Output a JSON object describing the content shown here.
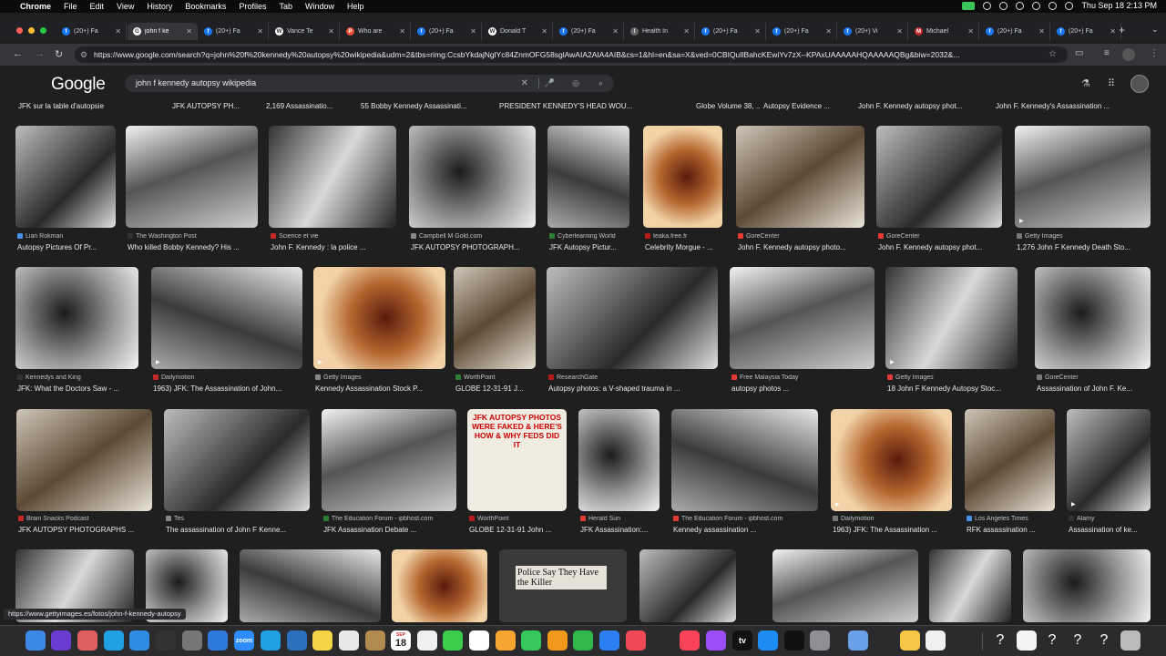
{
  "menubar": {
    "app": "Chrome",
    "items": [
      "File",
      "Edit",
      "View",
      "History",
      "Bookmarks",
      "Profiles",
      "Tab",
      "Window",
      "Help"
    ],
    "datetime": "Thu Sep 18  2:13 PM"
  },
  "tabs": [
    {
      "title": "(20+) Fa",
      "active": false,
      "fav": "f",
      "color": "#1877f2"
    },
    {
      "title": "john f ke",
      "active": true,
      "fav": "G",
      "color": "#ffffff"
    },
    {
      "title": "(20+) Fa",
      "active": false,
      "fav": "f",
      "color": "#1877f2"
    },
    {
      "title": "Vance Te",
      "active": false,
      "fav": "W",
      "color": "#ffffff"
    },
    {
      "title": "Who are",
      "active": false,
      "fav": "P",
      "color": "#e94f37"
    },
    {
      "title": "(20+) Fa",
      "active": false,
      "fav": "f",
      "color": "#1877f2"
    },
    {
      "title": "Donald T",
      "active": false,
      "fav": "W",
      "color": "#ffffff"
    },
    {
      "title": "(20+) Fa",
      "active": false,
      "fav": "f",
      "color": "#1877f2"
    },
    {
      "title": "Health In",
      "active": false,
      "fav": "!",
      "color": "#666666"
    },
    {
      "title": "(20+) Fa",
      "active": false,
      "fav": "f",
      "color": "#1877f2"
    },
    {
      "title": "(20+) Fa",
      "active": false,
      "fav": "f",
      "color": "#1877f2"
    },
    {
      "title": "(20+) Vi",
      "active": false,
      "fav": "f",
      "color": "#1877f2"
    },
    {
      "title": "Michael",
      "active": false,
      "fav": "M",
      "color": "#c62828"
    },
    {
      "title": "(20+) Fa",
      "active": false,
      "fav": "f",
      "color": "#1877f2"
    },
    {
      "title": "(20+) Fa",
      "active": false,
      "fav": "f",
      "color": "#1877f2"
    }
  ],
  "toolbar": {
    "url": "https://www.google.com/search?q=john%20f%20kennedy%20autopsy%20wikipedia&udm=2&tbs=rimg:CcsbYkdajNglYc84ZnmOFG58sglAwAIA2AIA4AIB&cs=1&hl=en&sa=X&ved=0CBIQuIlBahcKEwiYv7zX--KPAxUAAAAAHQAAAAAQBg&biw=2032&..."
  },
  "google": {
    "logo": "Google",
    "query": "john f kennedy autopsy wikipedia"
  },
  "results": {
    "top_captions": [
      "JFK sur la table d'autopsie",
      "JFK AUTOPSY PH...",
      "2,169 Assassinatio...",
      "55 Bobby Kennedy Assassinati...",
      "PRESIDENT KENNEDY'S HEAD WOU...",
      "Globe Volume 38, ...",
      "Autopsy Evidence ...",
      "John F. Kennedy autopsy phot...",
      "John F. Kennedy's Assassination ..."
    ],
    "rows": [
      [
        {
          "source": "Lian Rokman",
          "caption": "Autopsy Pictures Of Pr..."
        },
        {
          "source": "The Washington Post",
          "caption": "Who killed Bobby Kennedy? His ..."
        },
        {
          "source": "Science et vie",
          "caption": "John F. Kennedy : la police ..."
        },
        {
          "source": "Campbell M Gold.com",
          "caption": "JFK AUTOPSY PHOTOGRAPH..."
        },
        {
          "source": "Cyberlearning World",
          "caption": "JFK Autopsy Pictur..."
        },
        {
          "source": "teaka.free.fr",
          "caption": "Celebrity Morgue - ..."
        },
        {
          "source": "GoreCenter",
          "caption": "John F. Kennedy autopsy photo..."
        },
        {
          "source": "GoreCenter",
          "caption": "John F. Kennedy autopsy phot..."
        },
        {
          "source": "Getty Images",
          "caption": "1,276 John F Kennedy Death Sto..."
        }
      ],
      [
        {
          "source": "Kennedys and King",
          "caption": "JFK: What the Doctors Saw - ..."
        },
        {
          "source": "Dailymotion",
          "caption": "1963) JFK: The Assassination of John..."
        },
        {
          "source": "Getty Images",
          "caption": "Kennedy Assassination Stock P..."
        },
        {
          "source": "WorthPoint",
          "caption": "GLOBE 12-31-91 J..."
        },
        {
          "source": "ResearchGate",
          "caption": "Autopsy photos: a V-shaped trauma in ..."
        },
        {
          "source": "Free Malaysia Today",
          "caption": "autopsy photos ..."
        },
        {
          "source": "Getty Images",
          "caption": "18 John F Kennedy Autopsy Stoc..."
        },
        {
          "source": "GoreCenter",
          "caption": "Assassination of John F. Ke..."
        }
      ],
      [
        {
          "source": "Brain Snacks Podcast",
          "caption": "JFK AUTOPSY PHOTOGRAPHS ..."
        },
        {
          "source": "Tes",
          "caption": "The assassination of John F Kenne..."
        },
        {
          "source": "The Education Forum - ipbhost.com",
          "caption": "JFK Assassination Debate ..."
        },
        {
          "source": "WorthPoint",
          "caption": "GLOBE 12-31-91 John ..."
        },
        {
          "source": "Herald Sun",
          "caption": "JFK Assassination:..."
        },
        {
          "source": "The Education Forum - ipbhost.com",
          "caption": "Kennedy assassination ..."
        },
        {
          "source": "Dailymotion",
          "caption": "1963) JFK: The Assassination ..."
        },
        {
          "source": "Los Angeles Times",
          "caption": "RFK assassination ..."
        },
        {
          "source": "Alamy",
          "caption": "Assassination of ke..."
        }
      ]
    ],
    "thumb_text": {
      "globe_headline": "JFK AUTOPSY PHOTOS WERE FAKED & HERE'S HOW & WHY FEDS DID IT",
      "newspaper_headline": "Police Say They Have the Killer"
    }
  },
  "status_url": "https://www.gettyimages.es/fotos/john-f-kennedy-autopsy",
  "dock": {
    "calendar_month": "SEP",
    "calendar_day": "18",
    "zoom_label": "zoom",
    "tv_label": "tv"
  }
}
